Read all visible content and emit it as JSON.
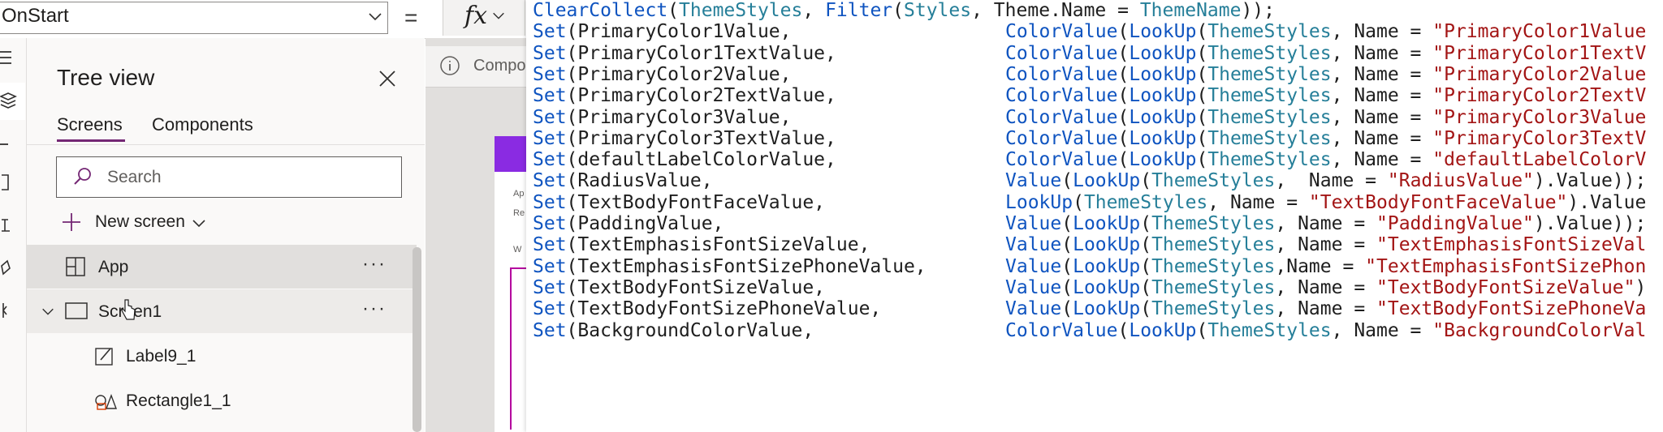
{
  "formula_bar": {
    "property": "OnStart",
    "equals": "=",
    "fx": "fx"
  },
  "tree_view": {
    "title": "Tree view",
    "tabs": [
      "Screens",
      "Components"
    ],
    "search_placeholder": "Search",
    "new_screen": "New screen",
    "items": [
      {
        "label": "App",
        "more": "···"
      },
      {
        "label": "Screen1",
        "more": "···"
      },
      {
        "label": "Label9_1"
      },
      {
        "label": "Rectangle1_1"
      }
    ]
  },
  "canvas": {
    "component_text": "Compo",
    "snippets": [
      "Ap",
      "Re",
      "W"
    ]
  },
  "code": {
    "lines": [
      [
        {
          "t": "ClearCollect",
          "c": "fn"
        },
        {
          "t": "(",
          "c": "pl"
        },
        {
          "t": "ThemeStyles",
          "c": "ty"
        },
        {
          "t": ", ",
          "c": "pl"
        },
        {
          "t": "Filter",
          "c": "fn"
        },
        {
          "t": "(",
          "c": "pl"
        },
        {
          "t": "Styles",
          "c": "ty"
        },
        {
          "t": ", Theme.Name = ",
          "c": "pl"
        },
        {
          "t": "ThemeName",
          "c": "ty"
        },
        {
          "t": "));",
          "c": "pl"
        }
      ],
      [
        {
          "t": "Set",
          "c": "fn"
        },
        {
          "t": "(PrimaryColor1Value,",
          "c": "pl"
        }
      ],
      [
        {
          "t": "Set",
          "c": "fn"
        },
        {
          "t": "(PrimaryColor1TextValue,",
          "c": "pl"
        }
      ],
      [
        {
          "t": "Set",
          "c": "fn"
        },
        {
          "t": "(PrimaryColor2Value,",
          "c": "pl"
        }
      ],
      [
        {
          "t": "Set",
          "c": "fn"
        },
        {
          "t": "(PrimaryColor2TextValue,",
          "c": "pl"
        }
      ],
      [
        {
          "t": "Set",
          "c": "fn"
        },
        {
          "t": "(PrimaryColor3Value,",
          "c": "pl"
        }
      ],
      [
        {
          "t": "Set",
          "c": "fn"
        },
        {
          "t": "(PrimaryColor3TextValue,",
          "c": "pl"
        }
      ],
      [
        {
          "t": "Set",
          "c": "fn"
        },
        {
          "t": "(defaultLabelColorValue,",
          "c": "pl"
        }
      ],
      [
        {
          "t": "Set",
          "c": "fn"
        },
        {
          "t": "(RadiusValue,",
          "c": "pl"
        }
      ],
      [
        {
          "t": "Set",
          "c": "fn"
        },
        {
          "t": "(TextBodyFontFaceValue,",
          "c": "pl"
        }
      ],
      [
        {
          "t": "Set",
          "c": "fn"
        },
        {
          "t": "(PaddingValue,",
          "c": "pl"
        }
      ],
      [
        {
          "t": "Set",
          "c": "fn"
        },
        {
          "t": "(TextEmphasisFontSizeValue,",
          "c": "pl"
        }
      ],
      [
        {
          "t": "Set",
          "c": "fn"
        },
        {
          "t": "(TextEmphasisFontSizePhoneValue,",
          "c": "pl"
        }
      ],
      [
        {
          "t": "Set",
          "c": "fn"
        },
        {
          "t": "(TextBodyFontSizeValue,",
          "c": "pl"
        }
      ],
      [
        {
          "t": "Set",
          "c": "fn"
        },
        {
          "t": "(TextBodyFontSizePhoneValue,",
          "c": "pl"
        }
      ],
      [
        {
          "t": "Set",
          "c": "fn"
        },
        {
          "t": "(BackgroundColorValue,",
          "c": "pl"
        }
      ]
    ],
    "right": [
      [],
      [
        {
          "t": "ColorValue",
          "c": "fn"
        },
        {
          "t": "(",
          "c": "pl"
        },
        {
          "t": "LookUp",
          "c": "fn"
        },
        {
          "t": "(",
          "c": "pl"
        },
        {
          "t": "ThemeStyles",
          "c": "ty"
        },
        {
          "t": ", Name = ",
          "c": "pl"
        },
        {
          "t": "\"PrimaryColor1Value",
          "c": "st"
        }
      ],
      [
        {
          "t": "ColorValue",
          "c": "fn"
        },
        {
          "t": "(",
          "c": "pl"
        },
        {
          "t": "LookUp",
          "c": "fn"
        },
        {
          "t": "(",
          "c": "pl"
        },
        {
          "t": "ThemeStyles",
          "c": "ty"
        },
        {
          "t": ", Name = ",
          "c": "pl"
        },
        {
          "t": "\"PrimaryColor1TextV",
          "c": "st"
        }
      ],
      [
        {
          "t": "ColorValue",
          "c": "fn"
        },
        {
          "t": "(",
          "c": "pl"
        },
        {
          "t": "LookUp",
          "c": "fn"
        },
        {
          "t": "(",
          "c": "pl"
        },
        {
          "t": "ThemeStyles",
          "c": "ty"
        },
        {
          "t": ", Name = ",
          "c": "pl"
        },
        {
          "t": "\"PrimaryColor2Value",
          "c": "st"
        }
      ],
      [
        {
          "t": "ColorValue",
          "c": "fn"
        },
        {
          "t": "(",
          "c": "pl"
        },
        {
          "t": "LookUp",
          "c": "fn"
        },
        {
          "t": "(",
          "c": "pl"
        },
        {
          "t": "ThemeStyles",
          "c": "ty"
        },
        {
          "t": ", Name = ",
          "c": "pl"
        },
        {
          "t": "\"PrimaryColor2TextV",
          "c": "st"
        }
      ],
      [
        {
          "t": "ColorValue",
          "c": "fn"
        },
        {
          "t": "(",
          "c": "pl"
        },
        {
          "t": "LookUp",
          "c": "fn"
        },
        {
          "t": "(",
          "c": "pl"
        },
        {
          "t": "ThemeStyles",
          "c": "ty"
        },
        {
          "t": ", Name = ",
          "c": "pl"
        },
        {
          "t": "\"PrimaryColor3Value",
          "c": "st"
        }
      ],
      [
        {
          "t": "ColorValue",
          "c": "fn"
        },
        {
          "t": "(",
          "c": "pl"
        },
        {
          "t": "LookUp",
          "c": "fn"
        },
        {
          "t": "(",
          "c": "pl"
        },
        {
          "t": "ThemeStyles",
          "c": "ty"
        },
        {
          "t": ", Name = ",
          "c": "pl"
        },
        {
          "t": "\"PrimaryColor3TextV",
          "c": "st"
        }
      ],
      [
        {
          "t": "ColorValue",
          "c": "fn"
        },
        {
          "t": "(",
          "c": "pl"
        },
        {
          "t": "LookUp",
          "c": "fn"
        },
        {
          "t": "(",
          "c": "pl"
        },
        {
          "t": "ThemeStyles",
          "c": "ty"
        },
        {
          "t": ", Name = ",
          "c": "pl"
        },
        {
          "t": "\"defaultLabelColorV",
          "c": "st"
        }
      ],
      [
        {
          "t": "Value",
          "c": "fn"
        },
        {
          "t": "(",
          "c": "pl"
        },
        {
          "t": "LookUp",
          "c": "fn"
        },
        {
          "t": "(",
          "c": "pl"
        },
        {
          "t": "ThemeStyles",
          "c": "ty"
        },
        {
          "t": ",  Name = ",
          "c": "pl"
        },
        {
          "t": "\"RadiusValue\"",
          "c": "st"
        },
        {
          "t": ").Value));",
          "c": "pl"
        }
      ],
      [
        {
          "t": "LookUp",
          "c": "fn"
        },
        {
          "t": "(",
          "c": "pl"
        },
        {
          "t": "ThemeStyles",
          "c": "ty"
        },
        {
          "t": ", Name = ",
          "c": "pl"
        },
        {
          "t": "\"TextBodyFontFaceValue\"",
          "c": "st"
        },
        {
          "t": ").Value",
          "c": "pl"
        }
      ],
      [
        {
          "t": "Value",
          "c": "fn"
        },
        {
          "t": "(",
          "c": "pl"
        },
        {
          "t": "LookUp",
          "c": "fn"
        },
        {
          "t": "(",
          "c": "pl"
        },
        {
          "t": "ThemeStyles",
          "c": "ty"
        },
        {
          "t": ", Name = ",
          "c": "pl"
        },
        {
          "t": "\"PaddingValue\"",
          "c": "st"
        },
        {
          "t": ").Value));",
          "c": "pl"
        }
      ],
      [
        {
          "t": "Value",
          "c": "fn"
        },
        {
          "t": "(",
          "c": "pl"
        },
        {
          "t": "LookUp",
          "c": "fn"
        },
        {
          "t": "(",
          "c": "pl"
        },
        {
          "t": "ThemeStyles",
          "c": "ty"
        },
        {
          "t": ", Name = ",
          "c": "pl"
        },
        {
          "t": "\"TextEmphasisFontSizeVal",
          "c": "st"
        }
      ],
      [
        {
          "t": "Value",
          "c": "fn"
        },
        {
          "t": "(",
          "c": "pl"
        },
        {
          "t": "LookUp",
          "c": "fn"
        },
        {
          "t": "(",
          "c": "pl"
        },
        {
          "t": "ThemeStyles",
          "c": "ty"
        },
        {
          "t": ",Name = ",
          "c": "pl"
        },
        {
          "t": "\"TextEmphasisFontSizePhon",
          "c": "st"
        }
      ],
      [
        {
          "t": "Value",
          "c": "fn"
        },
        {
          "t": "(",
          "c": "pl"
        },
        {
          "t": "LookUp",
          "c": "fn"
        },
        {
          "t": "(",
          "c": "pl"
        },
        {
          "t": "ThemeStyles",
          "c": "ty"
        },
        {
          "t": ", Name = ",
          "c": "pl"
        },
        {
          "t": "\"TextBodyFontSizeValue\"",
          "c": "st"
        },
        {
          "t": ")",
          "c": "pl"
        }
      ],
      [
        {
          "t": "Value",
          "c": "fn"
        },
        {
          "t": "(",
          "c": "pl"
        },
        {
          "t": "LookUp",
          "c": "fn"
        },
        {
          "t": "(",
          "c": "pl"
        },
        {
          "t": "ThemeStyles",
          "c": "ty"
        },
        {
          "t": ", Name = ",
          "c": "pl"
        },
        {
          "t": "\"TextBodyFontSizePhoneVa",
          "c": "st"
        }
      ],
      [
        {
          "t": "ColorValue",
          "c": "fn"
        },
        {
          "t": "(",
          "c": "pl"
        },
        {
          "t": "LookUp",
          "c": "fn"
        },
        {
          "t": "(",
          "c": "pl"
        },
        {
          "t": "ThemeStyles",
          "c": "ty"
        },
        {
          "t": ", Name = ",
          "c": "pl"
        },
        {
          "t": "\"BackgroundColorVal",
          "c": "st"
        }
      ]
    ]
  },
  "icons": [
    "hamburger-icon",
    "layers-icon",
    "insert-icon",
    "data-icon",
    "media-icon",
    "tools-icon",
    "variables-icon",
    "close-icon",
    "search-icon",
    "plus-icon",
    "chevron-down-icon",
    "app-icon",
    "screen-icon",
    "label-icon",
    "shapes-icon",
    "info-icon"
  ],
  "colors": {
    "accent": "#742774",
    "code_function": "#0f54c0",
    "code_type": "#267f99",
    "code_string": "#a31515",
    "canvas_header": "#8a2be2"
  }
}
